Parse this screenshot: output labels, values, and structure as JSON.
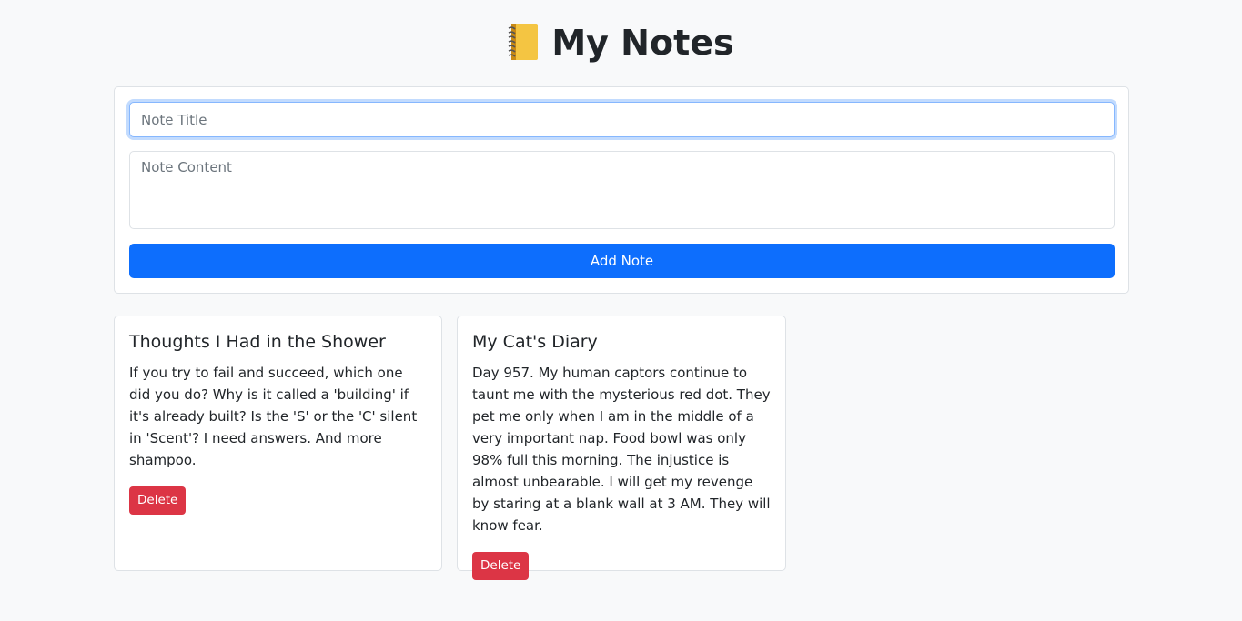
{
  "header": {
    "title": "My Notes",
    "icon": "notebook-icon"
  },
  "form": {
    "title_placeholder": "Note Title",
    "title_value": "",
    "content_placeholder": "Note Content",
    "content_value": "",
    "add_label": "Add Note"
  },
  "notes": [
    {
      "title": "Thoughts I Had in the Shower",
      "content": "If you try to fail and succeed, which one did you do? Why is it called a 'building' if it's already built? Is the 'S' or the 'C' silent in 'Scent'? I need answers. And more shampoo.",
      "delete_label": "Delete"
    },
    {
      "title": "My Cat's Diary",
      "content": "Day 957. My human captors continue to taunt me with the mysterious red dot. They pet me only when I am in the middle of a very important nap. Food bowl was only 98% full this morning. The injustice is almost unbearable. I will get my revenge by staring at a blank wall at 3 AM. They will know fear.",
      "delete_label": "Delete"
    }
  ],
  "colors": {
    "primary": "#0d6efd",
    "danger": "#dc3545",
    "background": "#f8f9fa"
  }
}
